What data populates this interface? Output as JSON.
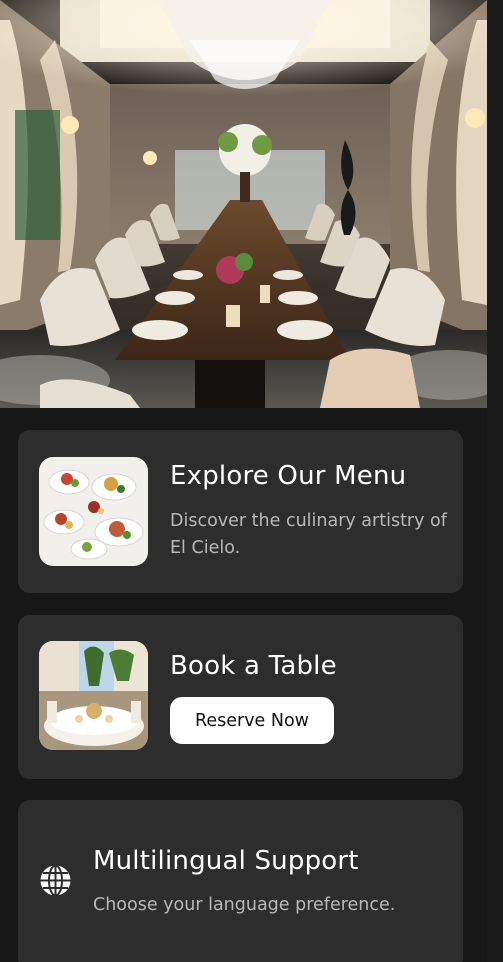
{
  "hero": {
    "image": "dining-room-photo"
  },
  "menu_card": {
    "title": "Explore Our Menu",
    "description": "Discover the culinary artistry of El Cielo.",
    "image": "plated-dishes-photo"
  },
  "book_card": {
    "title": "Book a Table",
    "button_label": "Reserve Now",
    "image": "outdoor-banquet-photo"
  },
  "language_card": {
    "title": "Multilingual Support",
    "description": "Choose your language preference.",
    "icon": "globe-icon"
  },
  "colors": {
    "background": "#171717",
    "card": "#2d2d2d",
    "button": "#ffffff",
    "muted_text": "#b9b9b9"
  }
}
